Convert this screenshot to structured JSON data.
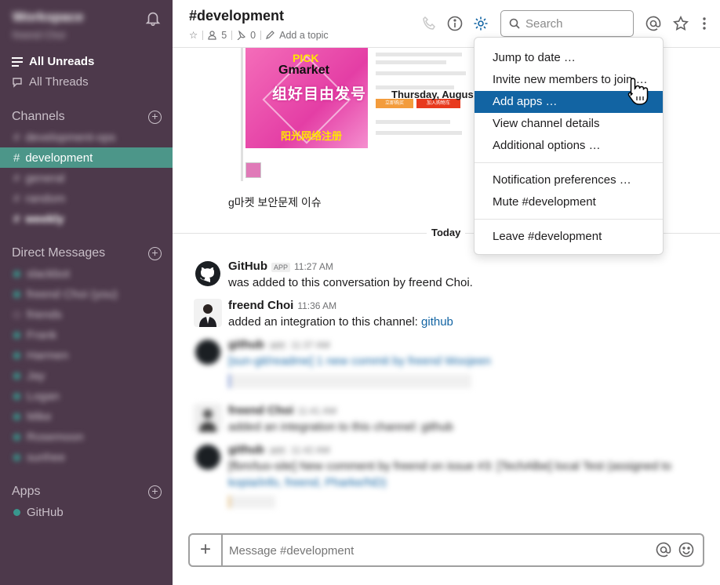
{
  "sidebar": {
    "workspace": "Workspace",
    "user": "freend Choi",
    "nav": {
      "all_unreads": "All Unreads",
      "all_threads": "All Threads"
    },
    "channels_title": "Channels",
    "channels": [
      {
        "name": "development-ops",
        "blurred": true
      },
      {
        "name": "development",
        "active": true
      },
      {
        "name": "general",
        "blurred": true
      },
      {
        "name": "random",
        "blurred": true
      },
      {
        "name": "weekly",
        "blurred": true
      }
    ],
    "dm_title": "Direct Messages",
    "dms": [
      "slackbot",
      "freend Choi (you)",
      "friends",
      "Frank",
      "Harmen",
      "Jay",
      "Logan",
      "Mike",
      "Rosemoon",
      "sunhee"
    ],
    "apps_title": "Apps",
    "apps": [
      "GitHub"
    ]
  },
  "header": {
    "channel_title": "#development",
    "members": "5",
    "pins": "0",
    "add_topic": "Add a topic",
    "search_placeholder": "Search"
  },
  "preview": {
    "img_line1": "PICK",
    "img_line2": "Gmarket",
    "img_line3": "组好目由发号",
    "img_line4": "阳光网络注册",
    "shop_btn1": "立即购买",
    "shop_btn2": "加入购物车",
    "date_header": "Thursday, August"
  },
  "korean_caption": "g마켓 보안문제 이슈",
  "day_divider": "Today",
  "messages": [
    {
      "sender": "GitHub",
      "badge": "APP",
      "time": "11:27 AM",
      "text": "was added to this conversation by freend Choi."
    },
    {
      "sender": "freend Choi",
      "time": "11:36 AM",
      "text_prefix": "added an integration to this channel: ",
      "link": "github"
    },
    {
      "sender": "github",
      "badge": "APP",
      "time": "11:37 AM",
      "text": "[sun-git/readme] 1 new commit by freend Woojeen"
    },
    {
      "sender": "freend Choi",
      "time": "11:41 AM",
      "text": "added an integration to this channel: github"
    },
    {
      "sender": "github",
      "badge": "APP",
      "time": "11:42 AM",
      "text": "[fbm/tuo-site] New comment by freend on issue #3: [TechAlbe] local Test (assigned to",
      "text2": "kopia/info, freend, Pharke/ND)"
    }
  ],
  "composer": {
    "placeholder": "Message #development"
  },
  "menu": {
    "items_a": [
      "Jump to date …",
      "Invite new members to join …",
      "Add apps …",
      "View channel details",
      "Additional options …"
    ],
    "items_b": [
      "Notification preferences …",
      "Mute #development"
    ],
    "items_c": [
      "Leave #development"
    ],
    "hover_index": 2
  },
  "colors": {
    "sidebar": "#4d394b",
    "active_channel": "#4c9689",
    "menu_hover": "#1264a3",
    "link": "#1264a3"
  }
}
